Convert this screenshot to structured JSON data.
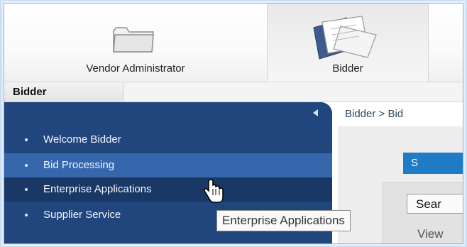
{
  "toolbar": {
    "items": [
      {
        "label": "Vendor Administrator",
        "icon": "folder-icon",
        "active": false
      },
      {
        "label": "Bidder",
        "icon": "documents-icon",
        "active": true
      }
    ]
  },
  "subtabs": {
    "items": [
      {
        "label": "Bidder"
      }
    ]
  },
  "nav": {
    "collapse_icon": "triangle-left-icon",
    "items": [
      {
        "label": "Welcome Bidder",
        "state": "normal"
      },
      {
        "label": "Bid Processing",
        "state": "selected"
      },
      {
        "label": "Enterprise Applications",
        "state": "hover"
      },
      {
        "label": "Supplier Service",
        "state": "normal"
      }
    ]
  },
  "content": {
    "breadcrumb": "Bidder  >  Bid",
    "blue_button": "S",
    "tab_button": "Sear",
    "view_label": "View"
  },
  "tooltip": {
    "text": "Enterprise Applications"
  },
  "cursor": {
    "icon": "hand-pointer-icon"
  },
  "colors": {
    "nav_bg": "#21467e",
    "nav_selected": "#3667ad",
    "nav_hover": "#193866",
    "button_blue": "#1f7bc4"
  }
}
